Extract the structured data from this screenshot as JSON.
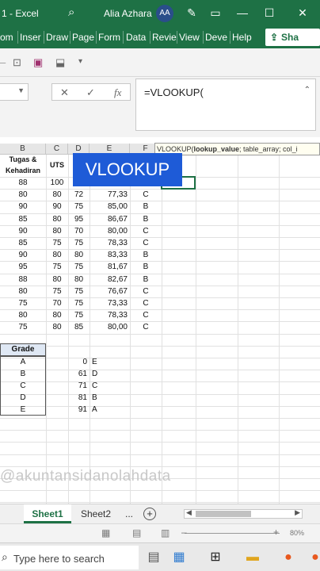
{
  "titlebar": {
    "title": "1 - Excel",
    "search_icon": "search-icon",
    "user_name": "Alia Azhara",
    "user_initials": "AA",
    "buttons": [
      "pen-icon",
      "restore-icon",
      "minimize-icon",
      "maximize-icon",
      "close-icon"
    ]
  },
  "ribbon": {
    "tabs": [
      "om",
      "Inser",
      "Draw",
      "Page",
      "Form",
      "Data",
      "Revie",
      "View",
      "Deve",
      "Help"
    ],
    "share_label": "Sha"
  },
  "formula_bar": {
    "cancel_symbol": "✕",
    "enter_symbol": "✓",
    "fx_symbol": "fx",
    "formula": "=VLOOKUP("
  },
  "columns": [
    "B",
    "C",
    "D",
    "E",
    "F"
  ],
  "header_row": {
    "tugas": "Tugas &",
    "kehadiran": "Kehadiran",
    "uts": "UTS"
  },
  "rows": [
    {
      "b": "88",
      "c": "100",
      "d": "",
      "e": "",
      "f": ""
    },
    {
      "b": "80",
      "c": "80",
      "d": "72",
      "e": "77,33",
      "f": "C"
    },
    {
      "b": "90",
      "c": "90",
      "d": "75",
      "e": "85,00",
      "f": "B"
    },
    {
      "b": "85",
      "c": "80",
      "d": "95",
      "e": "86,67",
      "f": "B"
    },
    {
      "b": "90",
      "c": "80",
      "d": "70",
      "e": "80,00",
      "f": "C"
    },
    {
      "b": "85",
      "c": "75",
      "d": "75",
      "e": "78,33",
      "f": "C"
    },
    {
      "b": "90",
      "c": "80",
      "d": "80",
      "e": "83,33",
      "f": "B"
    },
    {
      "b": "95",
      "c": "75",
      "d": "75",
      "e": "81,67",
      "f": "B"
    },
    {
      "b": "88",
      "c": "80",
      "d": "80",
      "e": "82,67",
      "f": "B"
    },
    {
      "b": "80",
      "c": "75",
      "d": "75",
      "e": "76,67",
      "f": "C"
    },
    {
      "b": "75",
      "c": "70",
      "d": "75",
      "e": "73,33",
      "f": "C"
    },
    {
      "b": "80",
      "c": "80",
      "d": "75",
      "e": "78,33",
      "f": "C"
    },
    {
      "b": "75",
      "c": "80",
      "d": "85",
      "e": "80,00",
      "f": "C"
    }
  ],
  "grade_table": {
    "header": "Grade",
    "grades": [
      "A",
      "B",
      "C",
      "D",
      "E"
    ]
  },
  "lookup_table": [
    {
      "min": "0",
      "grade": "E"
    },
    {
      "min": "61",
      "grade": "D"
    },
    {
      "min": "71",
      "grade": "C"
    },
    {
      "min": "81",
      "grade": "B"
    },
    {
      "min": "91",
      "grade": "A"
    }
  ],
  "banner": "VLOOKUP",
  "tooltip": {
    "fn": "VLOOKUP(",
    "arg1": "lookup_value",
    "rest": "; table_array; col_i"
  },
  "watermark": "@akuntansidanolahdata",
  "sheet_tabs": {
    "sheet1": "Sheet1",
    "sheet2": "Sheet2",
    "more": "...",
    "add": "+"
  },
  "status": {
    "zoom": "80%"
  },
  "taskbar": {
    "search_placeholder": "Type here to search",
    "apps": [
      "bag-icon",
      "maps-icon",
      "taskview-icon",
      "explorer-icon",
      "firefox-icon",
      "firefox-icon-2"
    ]
  },
  "colors": {
    "excel_green": "#1e7145",
    "banner_blue": "#1e5bd7"
  }
}
